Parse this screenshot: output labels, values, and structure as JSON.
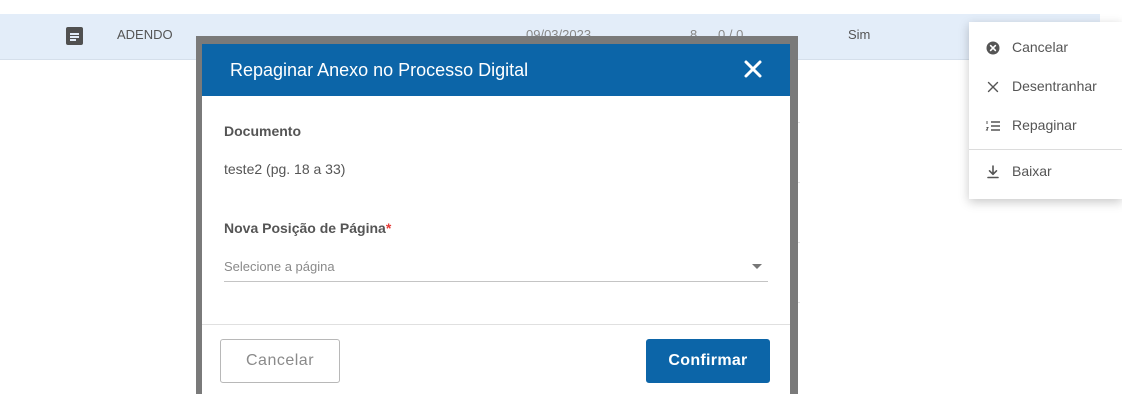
{
  "table_row": {
    "name": "ADENDO",
    "date": "09/03/2023",
    "count": "8",
    "pages": "0 / 0",
    "flag": "Sim"
  },
  "modal": {
    "title": "Repaginar Anexo no Processo Digital",
    "document_label": "Documento",
    "document_value": "teste2 (pg. 18 a 33)",
    "position_label": "Nova Posição de Página",
    "required_mark": "*",
    "select_placeholder": "Selecione a página",
    "cancel_label": "Cancelar",
    "confirm_label": "Confirmar"
  },
  "context_menu": {
    "items": [
      {
        "label": "Cancelar",
        "icon": "cancel-circle-icon"
      },
      {
        "label": "Desentranhar",
        "icon": "close-icon"
      },
      {
        "label": "Repaginar",
        "icon": "numbered-list-icon"
      },
      {
        "label": "Baixar",
        "icon": "download-icon"
      }
    ]
  },
  "colors": {
    "primary": "#0c65a8",
    "row_highlight": "#e3edf9",
    "required": "#e53935"
  }
}
